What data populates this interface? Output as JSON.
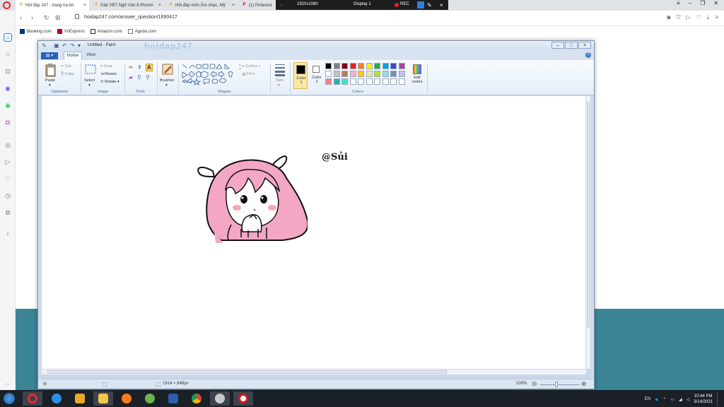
{
  "browser": {
    "tabs": [
      {
        "label": "Hỏi đáp 247 - trang tra lời",
        "favicon_color": "#e8a42a",
        "active": true
      },
      {
        "label": "Giải VBT Ngữ Văn 6 Phươn",
        "favicon_color": "#f08a24",
        "active": false
      },
      {
        "label": "Hỏi đáp môn Âm nhạc, Mỹ",
        "favicon_color": "#e8a42a",
        "active": false
      },
      {
        "label": "(1) Pinterest",
        "favicon_color": "#e60023",
        "active": false
      }
    ],
    "url": "hoidap247.com/answer_question/1690417",
    "bookmarks": [
      {
        "label": "Booking.com",
        "color": "#003580"
      },
      {
        "label": "VnExpress",
        "color": "#b1002b"
      },
      {
        "label": "Amazon.com",
        "color": "#222222"
      },
      {
        "label": "Agoda.com",
        "color": "#5a5a5a"
      }
    ]
  },
  "recorder": {
    "resolution": "1920x1080",
    "display": "Display 1",
    "rec_label": "REC"
  },
  "paint": {
    "title": "Untitled - Paint",
    "watermark": "hoidap247",
    "tabs": {
      "file": "",
      "home": "Home",
      "view": "View"
    },
    "clipboard": {
      "paste": "Paste",
      "cut": "Cut",
      "copy": "Copy",
      "label": "Clipboard"
    },
    "image": {
      "select": "Select",
      "crop": "Crop",
      "resize": "Resize",
      "rotate": "Rotate",
      "label": "Image"
    },
    "tools": {
      "label": "Tools"
    },
    "brushes": {
      "label": "Brushes"
    },
    "shapes": {
      "outline": "Outline",
      "fill": "Fill",
      "label": "Shapes"
    },
    "size": {
      "label": "Size"
    },
    "colors": {
      "color1": "Color 1",
      "color2": "Color 2",
      "edit": "Edit colors",
      "label": "Colors",
      "color1_value": "#000000",
      "color2_value": "#ffffff",
      "palette_row1": [
        "#000000",
        "#7f7f7f",
        "#880015",
        "#ed1c24",
        "#ff7f27",
        "#fff200",
        "#22b14c",
        "#00a2e8",
        "#3f48cc",
        "#a349a4"
      ],
      "palette_row2": [
        "#ffffff",
        "#c3c3c3",
        "#b97a57",
        "#ffaec9",
        "#ffc90e",
        "#efe4b0",
        "#b5e61d",
        "#99d9ea",
        "#7092be",
        "#c8bfe7"
      ],
      "palette_row3": [
        "#ff7f7f",
        "#20b2aa",
        "#40e0d0",
        "#ffffff",
        "#ffffff",
        "#ffffff",
        "#ffffff",
        "#ffffff",
        "#ffffff",
        "#ffffff"
      ]
    },
    "canvas_text": "@Sủi",
    "status": {
      "size": "1914 × 848px",
      "zoom": "100%"
    }
  },
  "taskbar": {
    "tray_lang": "EN",
    "time": "10:44 PM",
    "date": "3/14/2021"
  }
}
